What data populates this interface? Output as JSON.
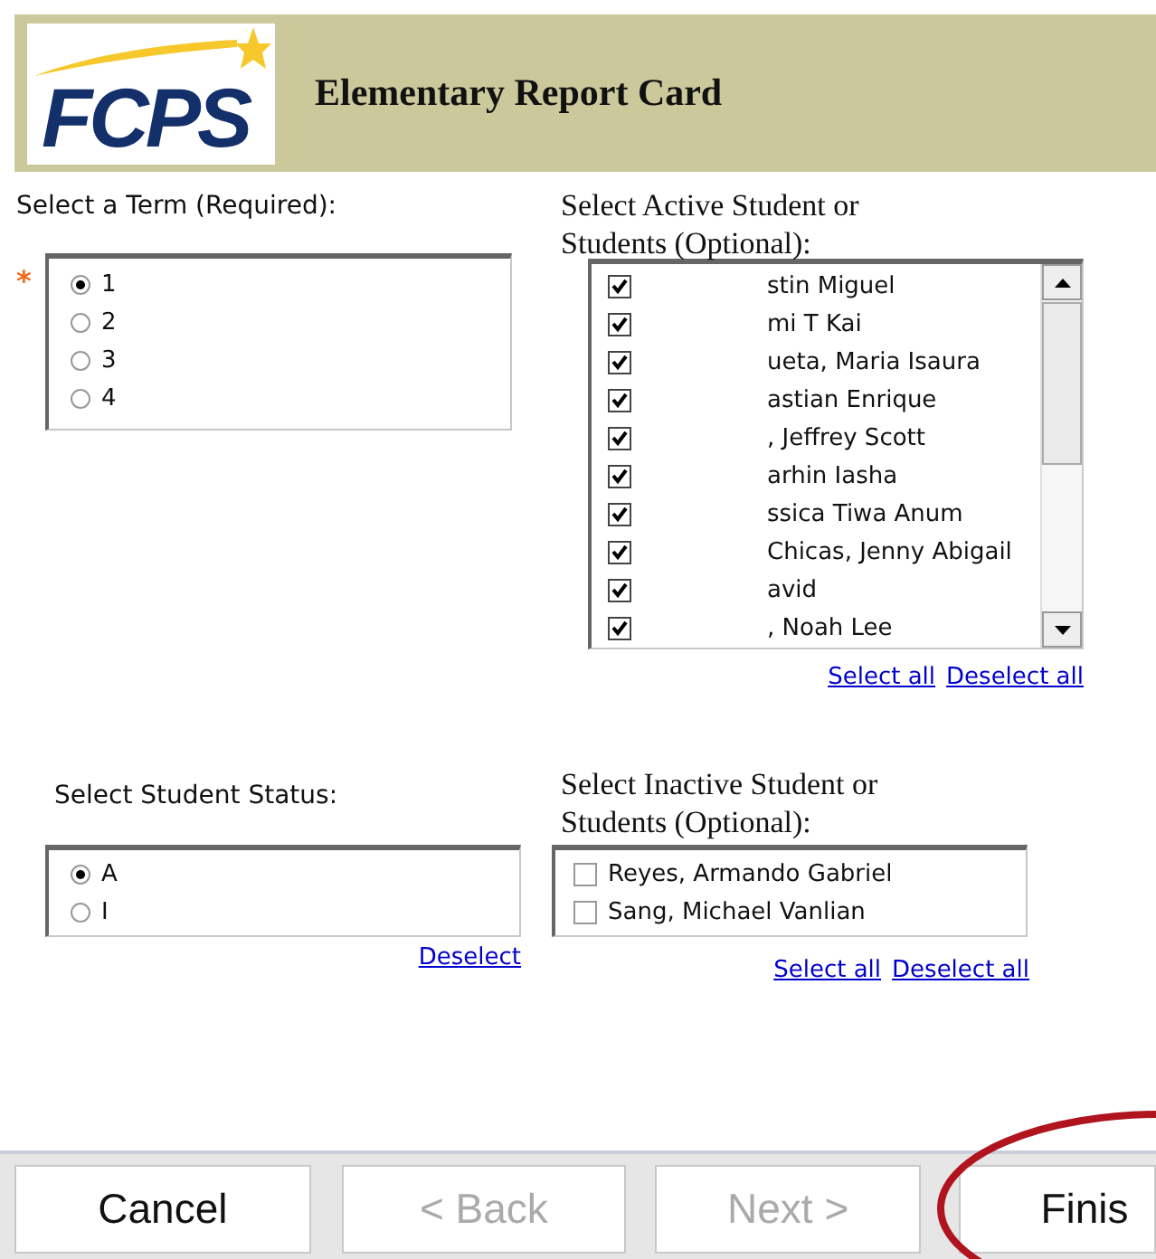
{
  "header": {
    "logo_text": "FCPS",
    "title": "Elementary Report Card"
  },
  "term": {
    "label": "Select a Term (Required):",
    "required_mark": "*",
    "options": [
      {
        "label": "1",
        "selected": true
      },
      {
        "label": "2",
        "selected": false
      },
      {
        "label": "3",
        "selected": false
      },
      {
        "label": "4",
        "selected": false
      }
    ]
  },
  "active_students": {
    "label": "Select Active Student or Students (Optional):",
    "items": [
      {
        "label": "stin Miguel",
        "checked": true
      },
      {
        "label": "mi T Kai",
        "checked": true
      },
      {
        "label": "ueta, Maria Isaura",
        "checked": true
      },
      {
        "label": "astian Enrique",
        "checked": true
      },
      {
        "label": ", Jeffrey Scott",
        "checked": true
      },
      {
        "label": "arhin Iasha",
        "checked": true
      },
      {
        "label": "ssica Tiwa Anum",
        "checked": true
      },
      {
        "label": "Chicas, Jenny Abigail",
        "checked": true
      },
      {
        "label": "avid",
        "checked": true
      },
      {
        "label": ", Noah Lee",
        "checked": true
      }
    ],
    "links": [
      "Select all",
      "Deselect all"
    ]
  },
  "status": {
    "label": "Select Student Status:",
    "options": [
      {
        "label": "A",
        "selected": true
      },
      {
        "label": "I",
        "selected": false
      }
    ],
    "links": [
      "Deselect"
    ]
  },
  "inactive_students": {
    "label": "Select Inactive Student or Students (Optional):",
    "items": [
      {
        "label": "Reyes, Armando Gabriel",
        "checked": false
      },
      {
        "label": "Sang, Michael Vanlian",
        "checked": false
      }
    ],
    "links": [
      "Select all",
      "Deselect all"
    ]
  },
  "buttons": [
    {
      "label": "Cancel",
      "disabled": false
    },
    {
      "label": "< Back",
      "disabled": true
    },
    {
      "label": "Next >",
      "disabled": true
    },
    {
      "label": "Finis",
      "disabled": false
    }
  ]
}
